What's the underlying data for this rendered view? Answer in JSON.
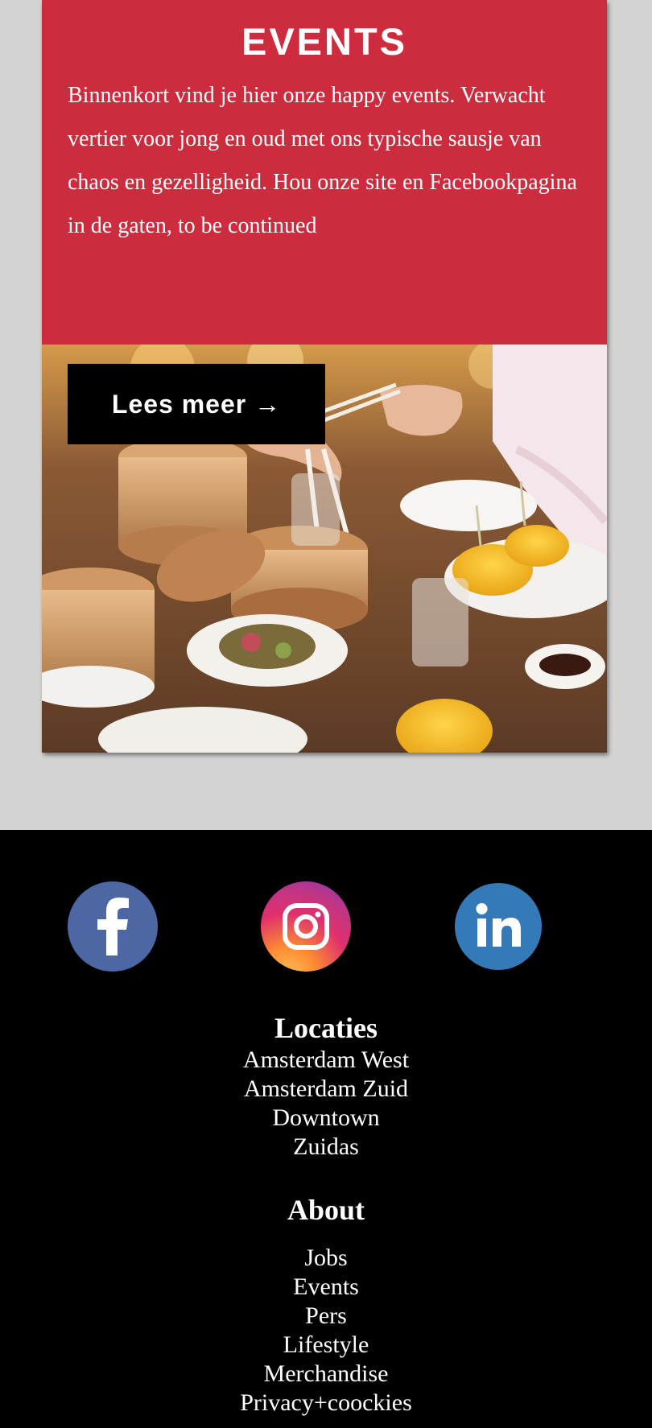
{
  "events": {
    "title": "EVENTS",
    "body": "Binnenkort vind je hier onze happy events. Verwacht vertier voor jong en oud met ons typische sausje van chaos en gezelligheid. Hou onze site en Facebookpagina in de gaten, to be continued",
    "button_label": "Lees meer →",
    "accent_color": "#cc2c3d",
    "image": "food-photo"
  },
  "footer": {
    "social": [
      {
        "name": "facebook-icon",
        "color": "#4d67a5"
      },
      {
        "name": "instagram-icon",
        "color": "#e1306c"
      },
      {
        "name": "linkedin-icon",
        "color": "#3479b8"
      }
    ],
    "locaties": {
      "heading": "Locaties",
      "items": [
        "Amsterdam West",
        "Amsterdam Zuid",
        "Downtown",
        "Zuidas"
      ]
    },
    "about": {
      "heading": "About",
      "items": [
        "Jobs",
        "Events",
        "Pers",
        "Lifestyle",
        "Merchandise",
        "Privacy+coockies"
      ]
    }
  }
}
